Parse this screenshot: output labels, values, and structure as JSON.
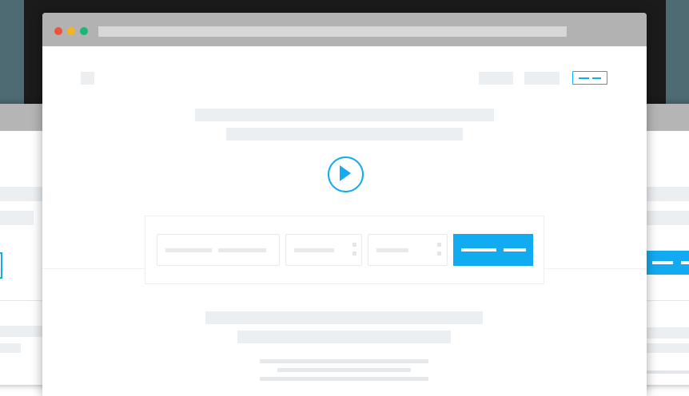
{
  "colors": {
    "accent": "#12aaf0",
    "placeholder_block": "#eceff2",
    "titlebar": "#b2b2b2",
    "address_bar": "#d7d7d7",
    "backdrop": "#1b1b1b",
    "backdrop_side": "#4e6a73",
    "window_close": "#f0513f",
    "window_minimize": "#f5b51c",
    "window_maximize": "#17b870"
  },
  "main_window": {
    "traffic_lights": [
      "close",
      "minimize",
      "maximize"
    ],
    "hero_icon": "play-icon"
  }
}
